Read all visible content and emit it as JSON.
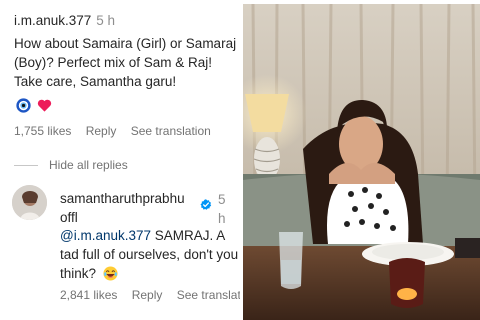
{
  "comment": {
    "username": "i.m.anuk.377",
    "time": "5 h",
    "text": "How about Samaira (Girl) or Samaraj (Boy)? Perfect mix of Sam & Raj! Take care, Samantha garu!",
    "emojis": [
      "nazar-amulet-icon",
      "heart-icon"
    ],
    "likes": "1,755 likes",
    "reply_label": "Reply",
    "translate_label": "See translation"
  },
  "hide_replies_label": "Hide all replies",
  "reply": {
    "username": "samantharuthprabhuoffl",
    "username_line1": "samantharuthprabhu",
    "username_line2": "offl",
    "verified": true,
    "time_line1": "5",
    "time_line2": "h",
    "mention": "@i.m.anuk.377",
    "text": " SAMRAJ. A tad full of ourselves, don't you think?",
    "emoji": "laughing-face-icon",
    "likes": "2,841 likes",
    "reply_label": "Reply",
    "translate_label": "See translatio"
  },
  "colors": {
    "text": "#262626",
    "secondary": "#737373",
    "mention": "#00376b",
    "verified": "#0095f6",
    "heart": "#ed1c5a"
  }
}
